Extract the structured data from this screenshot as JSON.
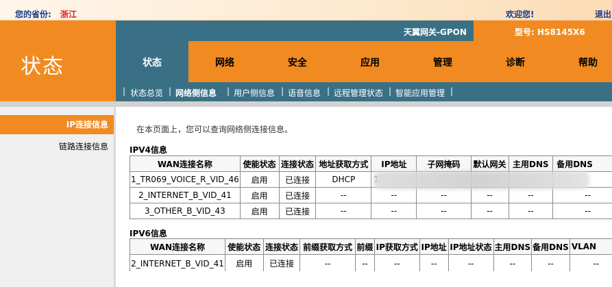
{
  "topbar": {
    "province_label": "您的省份:",
    "province_value": "浙江",
    "welcome": "欢迎您!",
    "logout": "退出"
  },
  "brand": {
    "section_title": "状态",
    "gateway_name": "天翼网关-GPON",
    "model_label": "型号: HS8145X6"
  },
  "main_nav": [
    {
      "label": "状态",
      "active": true
    },
    {
      "label": "网络",
      "active": false
    },
    {
      "label": "安全",
      "active": false
    },
    {
      "label": "应用",
      "active": false
    },
    {
      "label": "管理",
      "active": false
    },
    {
      "label": "诊断",
      "active": false
    },
    {
      "label": "帮助",
      "active": false
    }
  ],
  "sub_nav": [
    {
      "label": "状态总览",
      "active": false
    },
    {
      "label": "网络侧信息",
      "active": true
    },
    {
      "label": "用户侧信息",
      "active": false
    },
    {
      "label": "语音信息",
      "active": false
    },
    {
      "label": "远程管理状态",
      "active": false
    },
    {
      "label": "智能应用管理",
      "active": false
    }
  ],
  "sidebar": [
    {
      "label": "IP连接信息",
      "active": true
    },
    {
      "label": "链路连接信息",
      "active": false
    }
  ],
  "content": {
    "intro": "在本页面上，您可以查询网络侧连接信息。",
    "ipv4": {
      "title": "IPV4信息",
      "headers": [
        "WAN连接名称",
        "使能状态",
        "连接状态",
        "地址获取方式",
        "IP地址",
        "子网掩码",
        "默认网关",
        "主用DNS",
        "备用DNS"
      ],
      "rows": [
        [
          "1_TR069_VOICE_R_VID_46",
          "启用",
          "已连接",
          "DHCP",
          "1",
          "",
          "",
          "",
          ""
        ],
        [
          "2_INTERNET_B_VID_41",
          "启用",
          "已连接",
          "--",
          "--",
          "--",
          "--",
          "--",
          "--"
        ],
        [
          "3_OTHER_B_VID_43",
          "启用",
          "已连接",
          "--",
          "--",
          "--",
          "--",
          "--",
          "--"
        ]
      ]
    },
    "ipv6": {
      "title": "IPV6信息",
      "headers": [
        "WAN连接名称",
        "使能状态",
        "连接状态",
        "前缀获取方式",
        "前缀",
        "IP获取方式",
        "IP地址",
        "IP地址状态",
        "主用DNS",
        "备用DNS",
        "VLAN"
      ],
      "rows": [
        [
          "2_INTERNET_B_VID_41",
          "启用",
          "已连接",
          "--",
          "--",
          "--",
          "--",
          "--",
          "--",
          "--",
          "--"
        ]
      ]
    }
  }
}
